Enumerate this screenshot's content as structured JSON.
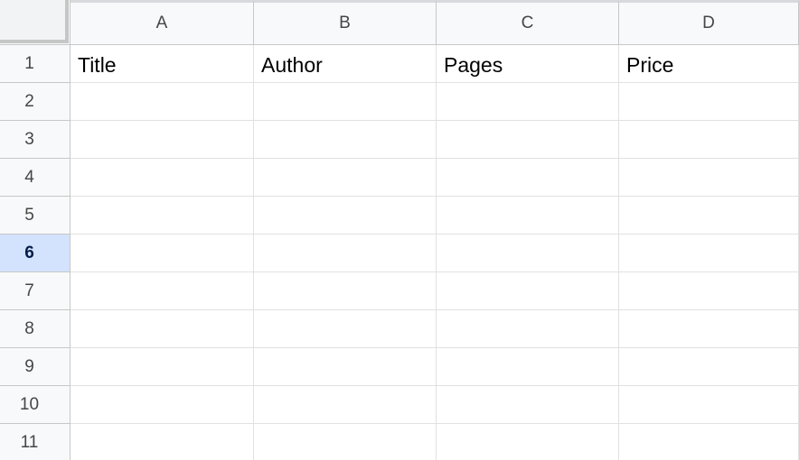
{
  "columns": [
    "A",
    "B",
    "C",
    "D"
  ],
  "rows": [
    "1",
    "2",
    "3",
    "4",
    "5",
    "6",
    "7",
    "8",
    "9",
    "10",
    "11"
  ],
  "selected_row": "6",
  "cells": [
    [
      "Title",
      "Author",
      "Pages",
      "Price"
    ],
    [
      "",
      "",
      "",
      ""
    ],
    [
      "",
      "",
      "",
      ""
    ],
    [
      "",
      "",
      "",
      ""
    ],
    [
      "",
      "",
      "",
      ""
    ],
    [
      "",
      "",
      "",
      ""
    ],
    [
      "",
      "",
      "",
      ""
    ],
    [
      "",
      "",
      "",
      ""
    ],
    [
      "",
      "",
      "",
      ""
    ],
    [
      "",
      "",
      "",
      ""
    ],
    [
      "",
      "",
      "",
      ""
    ]
  ],
  "colors": {
    "header_bg": "#f8f9fa",
    "selected_row_bg": "#d3e3fd",
    "selected_row_text": "#041e49",
    "gridline": "#e1e1e1"
  }
}
